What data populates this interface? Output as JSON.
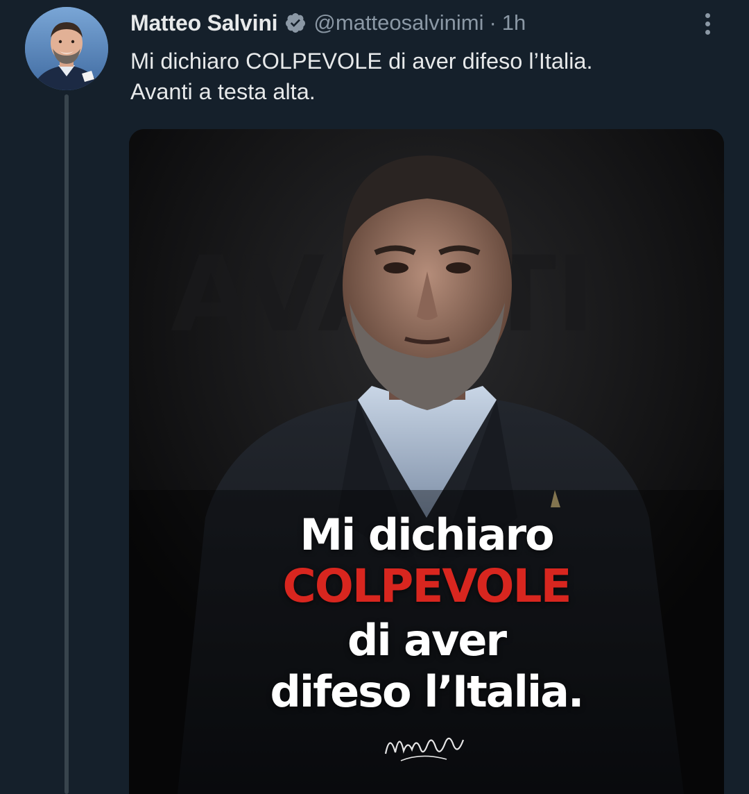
{
  "author": {
    "name": "Matteo Salvini",
    "handle": "@matteosalvinimi",
    "separator": "·",
    "time": "1h",
    "verified_icon": "verified-badge-icon"
  },
  "tweet": {
    "lines": [
      "Mi dichiaro COLPEVOLE di aver difeso l’Italia.",
      "Avanti a testa alta."
    ]
  },
  "media": {
    "poster_lines": [
      "Mi dichiaro",
      "COLPEVOLE",
      "di aver",
      "difeso l’Italia."
    ],
    "signature": "Matteo Salvini"
  },
  "colors": {
    "background": "#15202b",
    "text_primary": "#e7e9ea",
    "text_secondary": "#8b98a5",
    "poster_accent": "#d8261f"
  }
}
